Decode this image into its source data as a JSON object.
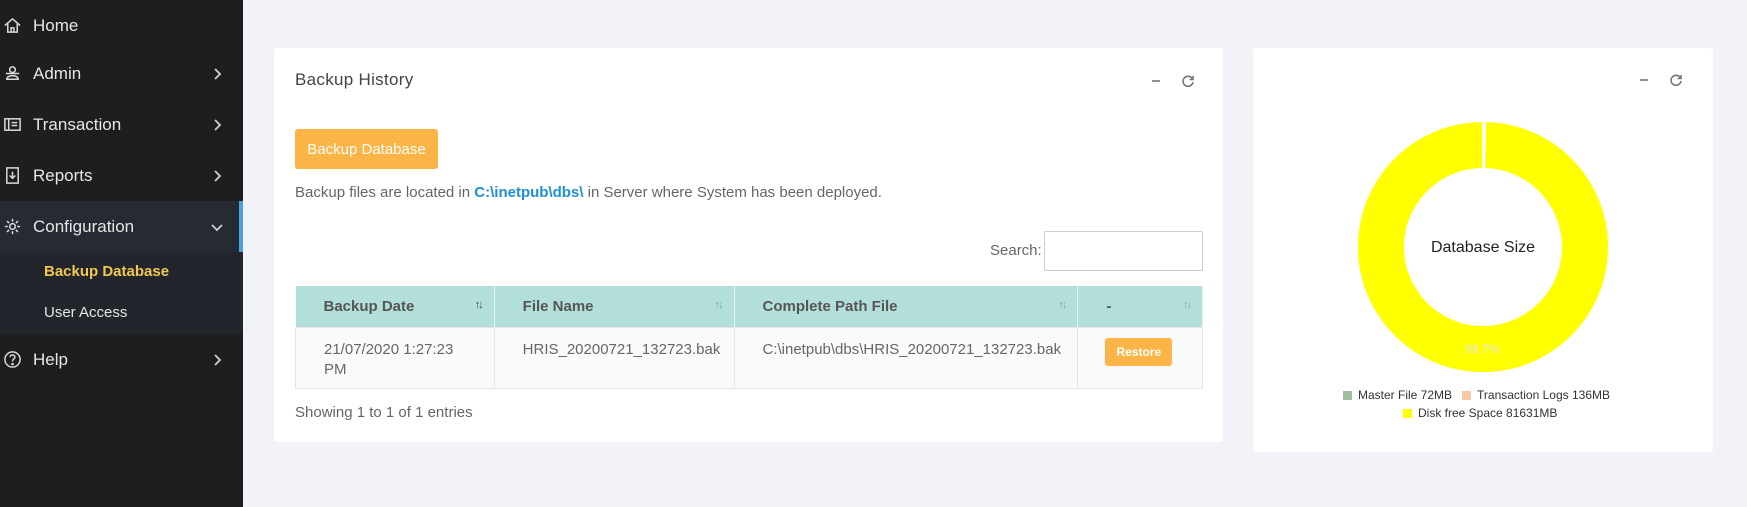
{
  "sidebar": {
    "items": [
      {
        "label": "Home",
        "icon": "home-icon",
        "has_chevron": false
      },
      {
        "label": "Admin",
        "icon": "users-icon",
        "has_chevron": true
      },
      {
        "label": "Transaction",
        "icon": "ledger-icon",
        "has_chevron": true
      },
      {
        "label": "Reports",
        "icon": "report-icon",
        "has_chevron": true
      },
      {
        "label": "Configuration",
        "icon": "gear-icon",
        "has_chevron": true,
        "expanded": true
      },
      {
        "label": "Help",
        "icon": "help-icon",
        "has_chevron": true
      }
    ],
    "subitems": [
      {
        "label": "Backup Database",
        "current": true
      },
      {
        "label": "User Access",
        "current": false
      }
    ]
  },
  "backup": {
    "title": "Backup History",
    "button_label": "Backup Database",
    "info_prefix": "Backup files are located in ",
    "info_path": "C:\\inetpub\\dbs\\",
    "info_suffix": " in Server where System has been deployed.",
    "search_label": "Search:",
    "search_value": "",
    "columns": [
      "Backup Date",
      "File Name",
      "Complete Path File",
      "-"
    ],
    "rows": [
      {
        "date": "21/07/2020 1:27:23 PM",
        "file": "HRIS_20200721_132723.bak",
        "path": "C:\\inetpub\\dbs\\HRIS_20200721_132723.bak",
        "action": "Restore"
      }
    ],
    "showing": "Showing 1 to 1 of 1 entries"
  },
  "chart_data": {
    "type": "pie",
    "title": "Database Size",
    "categories": [
      "Master File 72MB",
      "Transaction Logs 136MB",
      "Disk free Space 81631MB"
    ],
    "values": [
      72,
      136,
      81631
    ],
    "colors": [
      "#9dbf9e",
      "#f7c9a6",
      "#ffff00"
    ],
    "data_labels": [
      "",
      "",
      "99.7%"
    ],
    "legend_position": "bottom"
  },
  "colors": {
    "accent": "#fbb446",
    "sidebar_bg": "#1e1e1e",
    "table_header": "#b3dfdb",
    "active_sub": "#f2c94c",
    "link": "#1f8fd6"
  }
}
